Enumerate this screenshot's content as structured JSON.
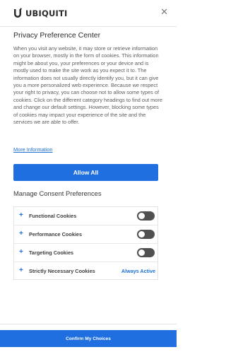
{
  "header": {
    "brand": "UBIQUITI",
    "logo_icon": "ubiquiti-logo-icon",
    "close_label": "✕"
  },
  "privacy": {
    "title": "Privacy Preference Center",
    "description": "When you visit any website, it may store or retrieve information on your browser, mostly in the form of cookies. This information might be about you, your preferences or your device and is mostly used to make the site work as you expect it to. The information does not usually directly identify you, but it can give you a more personalized web experience. Because we respect your right to privacy, you can choose not to allow some types of cookies. Click on the different category headings to find out more and change our default settings. However, blocking some types of cookies may impact your experience of the site and the services we are able to offer.",
    "more_info": "More Information"
  },
  "allow_all_label": "Allow All",
  "manage": {
    "title": "Manage Consent Preferences",
    "categories": [
      {
        "label": "Functional Cookies",
        "enabled": false
      },
      {
        "label": "Performance Cookies",
        "enabled": false
      },
      {
        "label": "Targeting Cookies",
        "enabled": false
      },
      {
        "label": "Strictly Necessary Cookies",
        "status": "Always Active"
      }
    ],
    "expand_symbol": "+"
  },
  "confirm_label": "Confirm My Choices",
  "colors": {
    "accent": "#1f6fe0",
    "toggle_off": "#505050"
  }
}
